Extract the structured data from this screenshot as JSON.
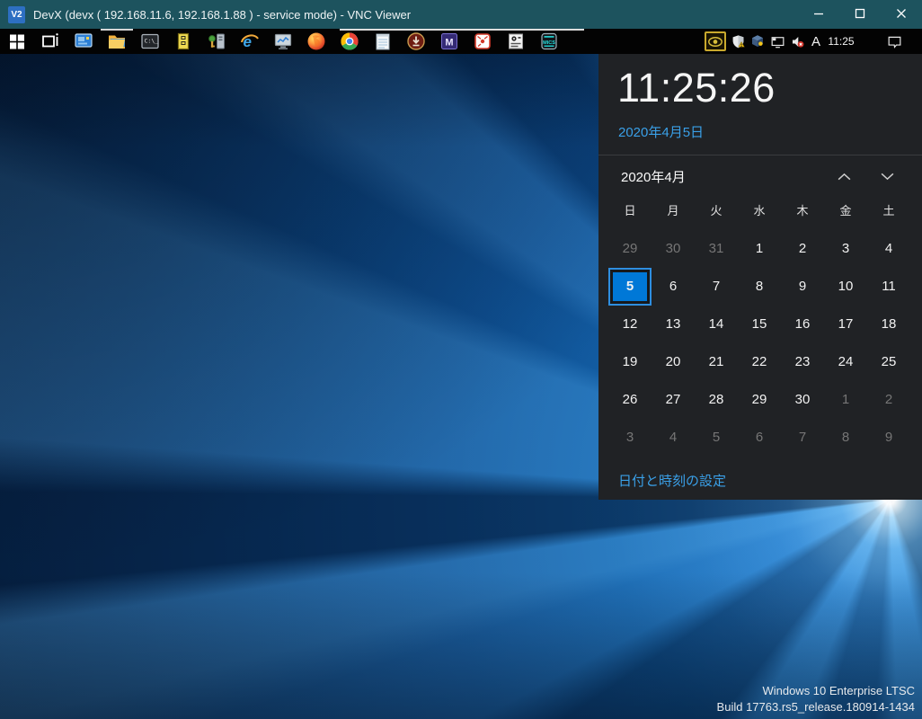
{
  "window": {
    "title": "DevX (devx ( 192.168.11.6, 192.168.1.88 ) - service mode) - VNC Viewer",
    "icon_label": "V2"
  },
  "taskbar": {
    "apps": [
      {
        "name": "start"
      },
      {
        "name": "task-view"
      },
      {
        "name": "display-settings"
      },
      {
        "name": "file-explorer"
      },
      {
        "name": "command-prompt"
      },
      {
        "name": "device-cabinet"
      },
      {
        "name": "computer-key"
      },
      {
        "name": "internet-explorer"
      },
      {
        "name": "performance-monitor"
      },
      {
        "name": "firefox"
      },
      {
        "name": "chrome"
      },
      {
        "name": "notepad"
      },
      {
        "name": "downloader"
      },
      {
        "name": "marktext"
      },
      {
        "name": "dice-app"
      },
      {
        "name": "clipboard-tool"
      },
      {
        "name": "mics-app"
      }
    ],
    "tray": {
      "ime_label": "A",
      "clock": "11:25"
    }
  },
  "flyout": {
    "time": "11:25:26",
    "date": "2020年4月5日",
    "month_label": "2020年4月",
    "weekdays": [
      "日",
      "月",
      "火",
      "水",
      "木",
      "金",
      "土"
    ],
    "rows": [
      [
        {
          "d": "29",
          "m": 1
        },
        {
          "d": "30",
          "m": 1
        },
        {
          "d": "31",
          "m": 1
        },
        {
          "d": "1"
        },
        {
          "d": "2"
        },
        {
          "d": "3"
        },
        {
          "d": "4"
        }
      ],
      [
        {
          "d": "5",
          "s": 1
        },
        {
          "d": "6"
        },
        {
          "d": "7"
        },
        {
          "d": "8"
        },
        {
          "d": "9"
        },
        {
          "d": "10"
        },
        {
          "d": "11"
        }
      ],
      [
        {
          "d": "12"
        },
        {
          "d": "13"
        },
        {
          "d": "14"
        },
        {
          "d": "15"
        },
        {
          "d": "16"
        },
        {
          "d": "17"
        },
        {
          "d": "18"
        }
      ],
      [
        {
          "d": "19"
        },
        {
          "d": "20"
        },
        {
          "d": "21"
        },
        {
          "d": "22"
        },
        {
          "d": "23"
        },
        {
          "d": "24"
        },
        {
          "d": "25"
        }
      ],
      [
        {
          "d": "26"
        },
        {
          "d": "27"
        },
        {
          "d": "28"
        },
        {
          "d": "29"
        },
        {
          "d": "30"
        },
        {
          "d": "1",
          "m": 1
        },
        {
          "d": "2",
          "m": 1
        }
      ],
      [
        {
          "d": "3",
          "m": 1
        },
        {
          "d": "4",
          "m": 1
        },
        {
          "d": "5",
          "m": 1
        },
        {
          "d": "6",
          "m": 1
        },
        {
          "d": "7",
          "m": 1
        },
        {
          "d": "8",
          "m": 1
        },
        {
          "d": "9",
          "m": 1
        }
      ]
    ],
    "settings_link": "日付と時刻の設定"
  },
  "desktop": {
    "os_edition": "Windows 10 Enterprise LTSC",
    "os_build": "Build 17763.rs5_release.180914-1434"
  },
  "colors": {
    "titlebar": "#1d535e",
    "taskbar": "#030303",
    "flyout_bg": "#202225",
    "accent": "#0078d7",
    "accent_text": "#3aa0e8",
    "muted_day": "#767676"
  }
}
